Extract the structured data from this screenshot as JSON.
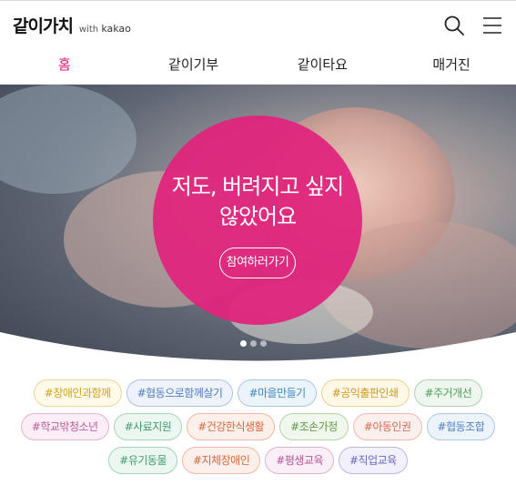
{
  "header": {
    "logo_main": "같이가치",
    "logo_with": "with",
    "logo_brand": "kakao"
  },
  "icons": {
    "search": "search-icon",
    "menu": "hamburger-menu-icon"
  },
  "nav": {
    "tabs": [
      {
        "label": "홈",
        "active": true
      },
      {
        "label": "같이기부",
        "active": false
      },
      {
        "label": "같이타요",
        "active": false
      },
      {
        "label": "매거진",
        "active": false
      }
    ]
  },
  "hero": {
    "title": "저도, 버려지고 싶지\n않았어요",
    "button_label": "참여하러가기",
    "slides": 3,
    "active_slide": 1
  },
  "colors": {
    "accent": "#e2197a",
    "hero_circle": "#e0247d"
  },
  "tags": [
    [
      {
        "label": "#장애인과함께",
        "color": "#d4a017",
        "bg": "#fffaea"
      },
      {
        "label": "#협동으로함께살기",
        "color": "#4f7bbf",
        "bg": "#eef3fb"
      },
      {
        "label": "#마을만들기",
        "color": "#3f86c4",
        "bg": "#ecf4fb"
      },
      {
        "label": "#공익출판인쇄",
        "color": "#c99a1a",
        "bg": "#fff8e6"
      },
      {
        "label": "#주거개선",
        "color": "#4e9c55",
        "bg": "#eef7ef"
      }
    ],
    [
      {
        "label": "#학교밖청소년",
        "color": "#c05a9a",
        "bg": "#fbeef6"
      },
      {
        "label": "#사료지원",
        "color": "#3e9d6e",
        "bg": "#ecf7f1"
      },
      {
        "label": "#건강한식생활",
        "color": "#d9663c",
        "bg": "#fdf0ea"
      },
      {
        "label": "#조손가정",
        "color": "#5d9a4a",
        "bg": "#f0f7ec"
      },
      {
        "label": "#아동인권",
        "color": "#d16a5a",
        "bg": "#fcefec"
      },
      {
        "label": "#협동조합",
        "color": "#4d82c4",
        "bg": "#edf3fb"
      }
    ],
    [
      {
        "label": "#유기동물",
        "color": "#3e9d6e",
        "bg": "#ecf7f1"
      },
      {
        "label": "#지체장애인",
        "color": "#d9663c",
        "bg": "#fdf0ea"
      },
      {
        "label": "#평생교육",
        "color": "#b5559a",
        "bg": "#faeef7"
      },
      {
        "label": "#직업교육",
        "color": "#6a68c0",
        "bg": "#f1f0fb"
      }
    ]
  ]
}
